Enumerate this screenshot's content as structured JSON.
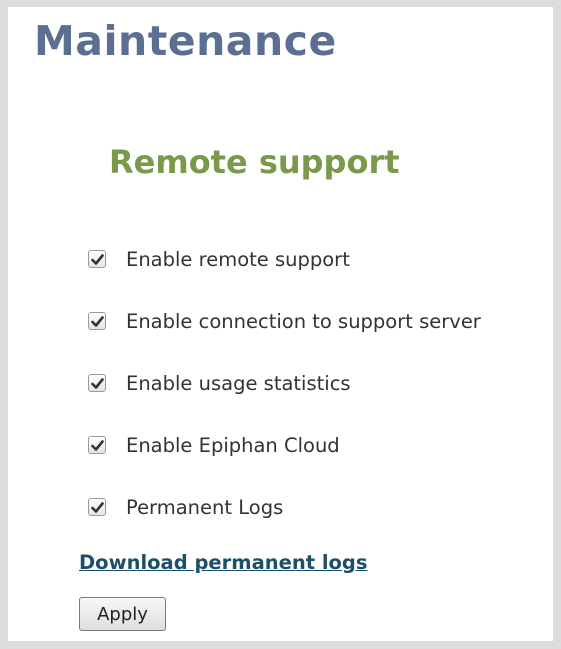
{
  "page": {
    "title": "Maintenance"
  },
  "remote_support": {
    "heading": "Remote support",
    "options": [
      {
        "label": "Enable remote support",
        "checked": true
      },
      {
        "label": "Enable connection to support server",
        "checked": true
      },
      {
        "label": "Enable usage statistics",
        "checked": true
      },
      {
        "label": "Enable Epiphan Cloud",
        "checked": true
      },
      {
        "label": "Permanent Logs",
        "checked": true
      }
    ],
    "download_link": "Download permanent logs",
    "apply_label": "Apply"
  },
  "colors": {
    "title": "#5b6f93",
    "heading": "#7a9a4a",
    "link": "#1d4f68",
    "frame": "#dcdcdc"
  },
  "icons": {
    "checkbox_checked": "checkmark-icon"
  }
}
